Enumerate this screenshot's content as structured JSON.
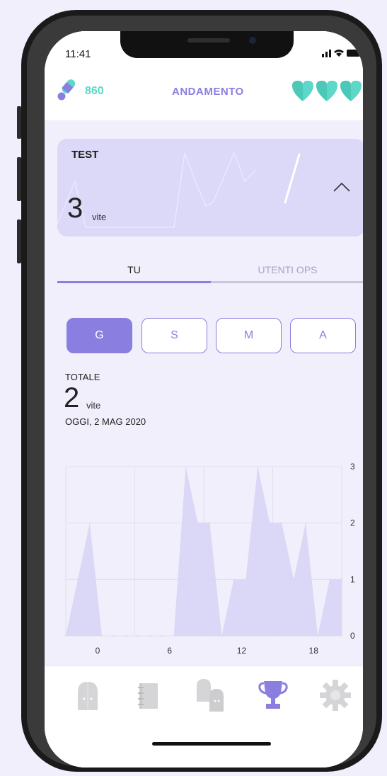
{
  "status": {
    "time": "11:41"
  },
  "header": {
    "score": "860",
    "title": "ANDAMENTO",
    "hearts": 3
  },
  "test_card": {
    "title": "TEST",
    "value": "3",
    "unit": "vite"
  },
  "tabs": [
    {
      "label": "TU",
      "active": true
    },
    {
      "label": "UTENTI OPS",
      "active": false
    }
  ],
  "periods": [
    {
      "label": "G",
      "active": true
    },
    {
      "label": "S",
      "active": false
    },
    {
      "label": "M",
      "active": false
    },
    {
      "label": "A",
      "active": false
    }
  ],
  "totale": {
    "label": "TOTALE",
    "value": "2",
    "unit": "vite",
    "date": "OGGI, 2 MAG 2020"
  },
  "chart_data": {
    "type": "area",
    "x": [
      0,
      1,
      2,
      3,
      4,
      5,
      6,
      7,
      8,
      9,
      10,
      11,
      12,
      13,
      14,
      15,
      16,
      17,
      18,
      19,
      20,
      21,
      22,
      23
    ],
    "values": [
      0,
      1,
      2,
      0,
      0,
      0,
      0,
      0,
      0,
      0,
      3,
      2,
      2,
      0,
      1,
      1,
      3,
      2,
      2,
      1,
      2,
      0,
      1,
      1
    ],
    "x_ticks": [
      "0",
      "6",
      "12",
      "18"
    ],
    "y_ticks": [
      "0",
      "1",
      "2",
      "3"
    ],
    "ylim": [
      0,
      3
    ],
    "grid": true
  },
  "colors": {
    "accent": "#8a7fe0",
    "mint": "#5dd8c8",
    "area": "#d9d5f6",
    "bg": "#f1effb"
  },
  "nav": [
    {
      "icon": "door-icon",
      "active": false
    },
    {
      "icon": "notebook-icon",
      "active": false
    },
    {
      "icon": "doors-icon",
      "active": false
    },
    {
      "icon": "trophy-icon",
      "active": true
    },
    {
      "icon": "gear-icon",
      "active": false
    }
  ]
}
